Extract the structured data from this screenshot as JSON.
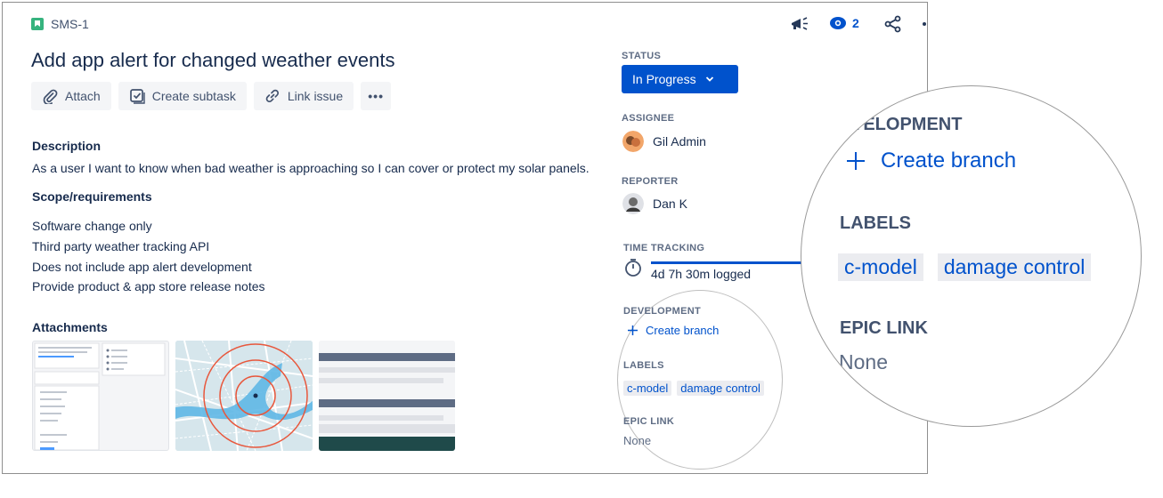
{
  "issue": {
    "key": "SMS-1",
    "title": "Add app alert for changed weather events"
  },
  "header_actions": {
    "watch_count": "2"
  },
  "toolbar": {
    "attach": "Attach",
    "create_subtask": "Create subtask",
    "link_issue": "Link issue",
    "more": "•••"
  },
  "description": {
    "heading": "Description",
    "text": "As a user I want to know when bad weather is approaching so I can cover or protect my solar panels.",
    "scope_heading": "Scope/requirements",
    "requirements": [
      "Software change only",
      "Third party weather tracking API",
      "Does not include app alert development",
      "Provide product & app store release notes"
    ]
  },
  "attachments": {
    "heading": "Attachments"
  },
  "details": {
    "status_label": "STATUS",
    "status_value": "In Progress",
    "assignee_label": "ASSIGNEE",
    "assignee_name": "Gil Admin",
    "reporter_label": "REPORTER",
    "reporter_name": "Dan K",
    "time_tracking_label": "TIME TRACKING",
    "time_logged": "4d 7h 30m logged",
    "development_label": "DEVELOPMENT",
    "create_branch": "Create branch",
    "labels_label": "LABELS",
    "labels": [
      "c-model",
      "damage control"
    ],
    "epic_link_label": "EPIC LINK",
    "epic_link_value": "None"
  },
  "magnifier": {
    "development_label": "VELOPMENT",
    "create_branch": "Create branch",
    "labels_label": "LABELS",
    "labels": [
      "c-model",
      "damage control"
    ],
    "epic_link_label": "EPIC LINK",
    "epic_link_value": "None"
  },
  "colors": {
    "primary": "#0052cc",
    "text": "#172b4d",
    "subtle": "#5e6c84",
    "chip_bg": "#ebecf0",
    "story_green": "#36b37e"
  },
  "icons": [
    "story-icon",
    "megaphone-icon",
    "eye-icon",
    "share-icon",
    "more-icon",
    "paperclip-icon",
    "subtask-icon",
    "link-icon",
    "chevron-down-icon",
    "stopwatch-icon",
    "plus-icon"
  ]
}
